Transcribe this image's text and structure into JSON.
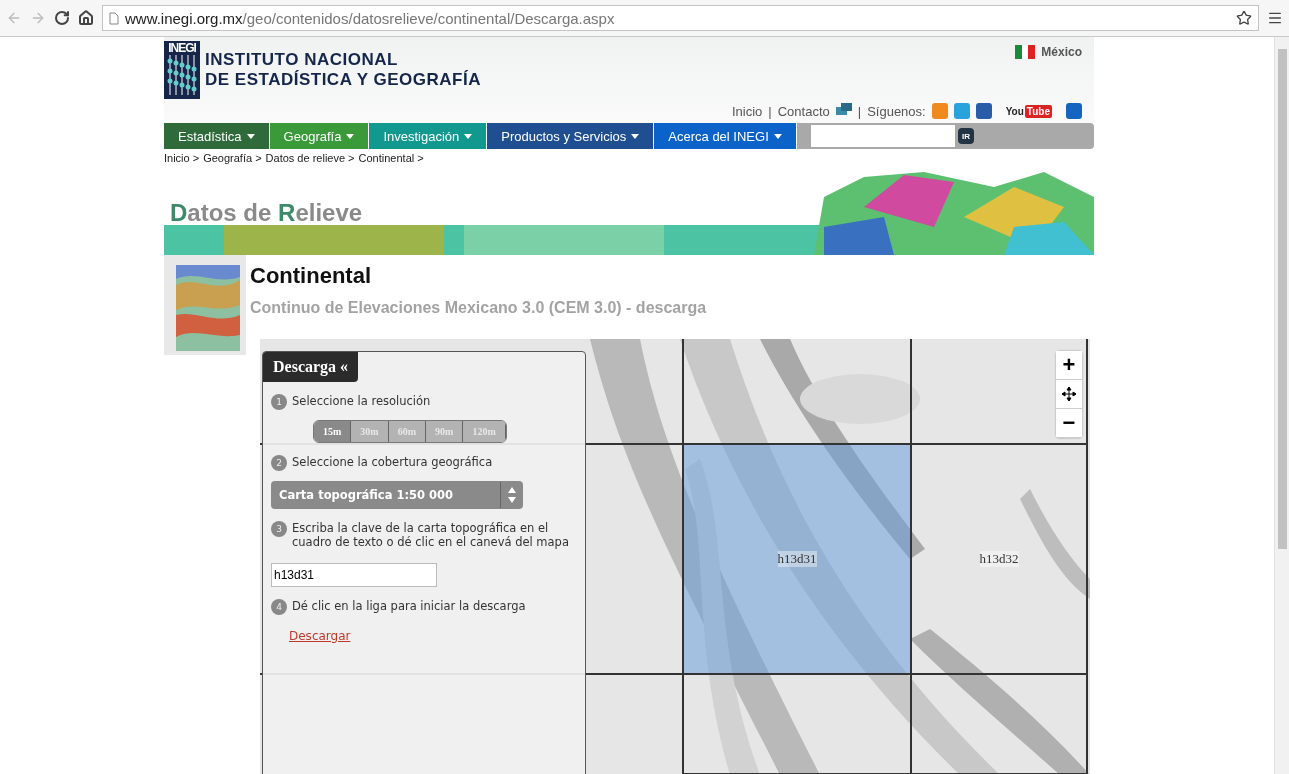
{
  "browser": {
    "url_host": "www.inegi.org.mx",
    "url_path": "/geo/contenidos/datosrelieve/continental/Descarga.aspx"
  },
  "header": {
    "logo_mark": "INEGI",
    "logo_line1": "INSTITUTO NACIONAL",
    "logo_line2": "DE ESTADÍSTICA Y GEOGRAFÍA",
    "country": "México",
    "links": [
      "Inicio",
      "Contacto"
    ],
    "separator": "|",
    "follow": "Síguenos:",
    "youtube_a": "You",
    "youtube_b": "Tube"
  },
  "nav": [
    {
      "label": "Estadística",
      "color": "#2f6b3a"
    },
    {
      "label": "Geografía",
      "color": "#3a9a3a"
    },
    {
      "label": "Investigación",
      "color": "#12998f"
    },
    {
      "label": "Productos y Servicios",
      "color": "#1f4e91"
    },
    {
      "label": "Acerca del INEGI",
      "color": "#0b63c9"
    }
  ],
  "search": {
    "button": "IR"
  },
  "breadcrumb": [
    "Inicio >",
    "Geografía >",
    "Datos de relieve >",
    "Continental >"
  ],
  "banner": {
    "title": [
      {
        "text": "D",
        "accent": true
      },
      {
        "text": "atos de ",
        "accent": false
      },
      {
        "text": "R",
        "accent": true
      },
      {
        "text": "elieve",
        "accent": false
      }
    ]
  },
  "page": {
    "title": "Continental",
    "subtitle": "Continuo de Elevaciones Mexicano 3.0 (CEM 3.0) - descarga"
  },
  "panel": {
    "title": "Descarga",
    "collapse": "«",
    "steps": [
      {
        "number": "1",
        "text": "Seleccione la resolución",
        "kind": "resolution"
      },
      {
        "number": "2",
        "text": "Seleccione la cobertura geográfica",
        "kind": "select"
      },
      {
        "number": "3",
        "text": "Escriba la clave de la carta topográfica en el cuadro de texto o dé clic en el canevá del mapa",
        "kind": "input"
      },
      {
        "number": "4",
        "text": "Dé clic en la liga para iniciar la descarga",
        "kind": "link"
      }
    ],
    "resolutions": [
      {
        "label": "15m",
        "selected": true
      },
      {
        "label": "30m",
        "selected": false
      },
      {
        "label": "60m",
        "selected": false
      },
      {
        "label": "90m",
        "selected": false
      },
      {
        "label": "120m",
        "selected": false
      }
    ],
    "coverage": "Carta topográfica 1:50 000",
    "key_value": "h13d31",
    "download": "Descargar"
  },
  "map": {
    "zoom_in": "+",
    "zoom_out": "−",
    "tiles": [
      {
        "selected": false
      },
      {
        "selected": false
      },
      {
        "label": "h13d31",
        "selected": true
      },
      {
        "label": "h13d32",
        "selected": false
      },
      {
        "selected": false
      },
      {
        "selected": false
      }
    ]
  }
}
